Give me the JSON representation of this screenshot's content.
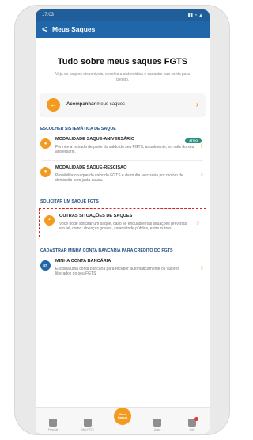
{
  "status": {
    "time": "17:03",
    "right": "▮▮ ◔ ▲"
  },
  "appbar": {
    "back": "<",
    "title": "Meus Saques"
  },
  "hero": {
    "title": "Tudo sobre meus saques FGTS",
    "subtitle": "Veja os saques disponíveis, escolha a sistemática e cadastre sua conta para crédito."
  },
  "track": {
    "bold": "Acompanhar",
    "rest": " meus saques"
  },
  "sections": {
    "escolher": "ESCOLHER SISTEMÁTICA DE SAQUE",
    "solicitar": "SOLICITAR UM SAQUE FGTS",
    "cadastrar": "CADASTRAR MINHA CONTA BANCÁRIA PARA CRÉDITO DO FGTS"
  },
  "cards": {
    "aniversario": {
      "title": "MODALIDADE SAQUE-ANIVERSÁRIO",
      "badge": "ATIVO",
      "desc": "Permite a retirada de parte do saldo do seu FGTS, anualmente, no mês do seu aniversário."
    },
    "rescisao": {
      "title": "MODALIDADE SAQUE-RESCISÃO",
      "desc": "Possibilita o saque do valor do FGTS e da multa rescisória por motivo de demissão sem justa causa."
    },
    "outras": {
      "title": "OUTRAS SITUAÇÕES DE SAQUES",
      "desc": "Você pode solicitar um saque, caso se enquadre nas situações previstas em lei, como: doenças graves, calamidade pública, entre outros."
    },
    "conta": {
      "title": "MINHA CONTA BANCÁRIA",
      "desc": "Escolha uma conta bancária para receber automaticamente os valores liberados do seu FGTS"
    }
  },
  "nav": {
    "home": "Principal",
    "fgts": "Meu FGTS",
    "saques": "Meus Saques",
    "ajuda": "Ajuda",
    "mais": "Mais"
  },
  "colors": {
    "blue": "#1f67a8",
    "orange": "#f39a1f",
    "highlight": "#d92020"
  }
}
